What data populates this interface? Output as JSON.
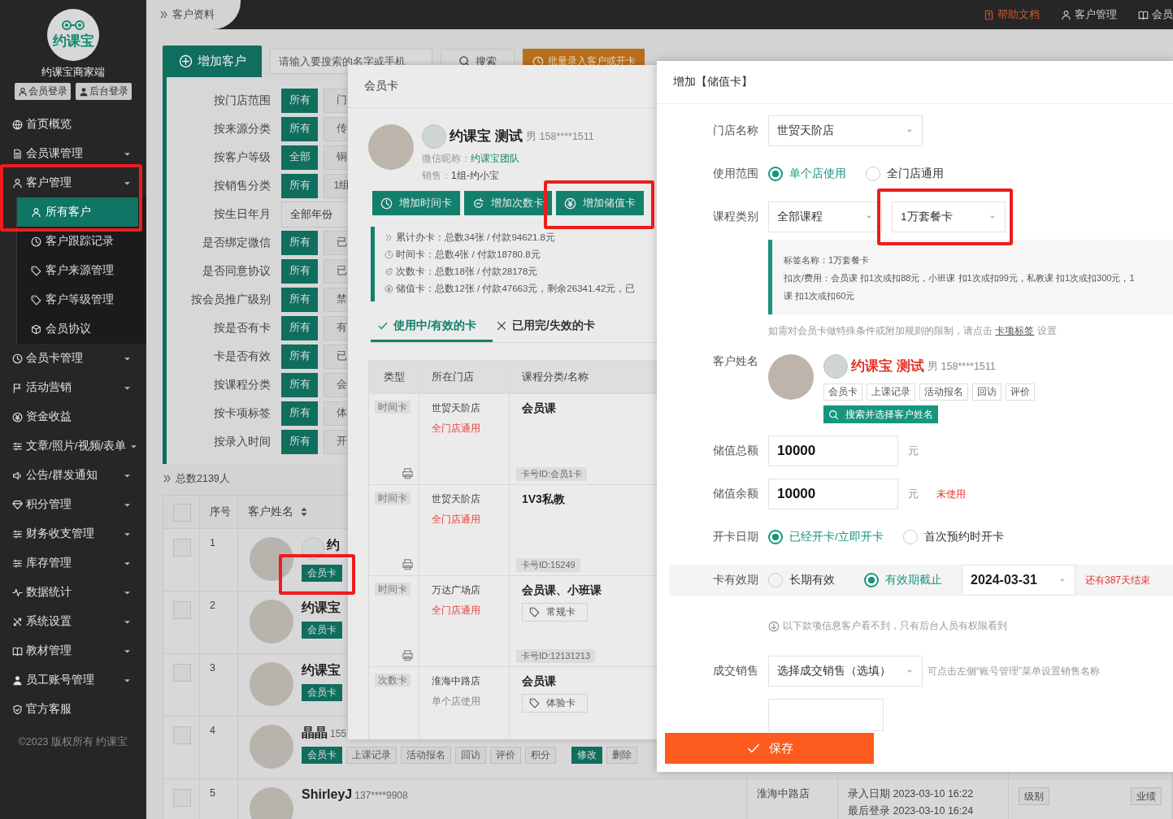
{
  "top_bar": {
    "breadcrumb": "客户资料",
    "links": [
      {
        "label": "帮助文档",
        "kind": "help"
      },
      {
        "label": "客户管理",
        "kind": "person"
      },
      {
        "label": "会员",
        "kind": "book"
      }
    ]
  },
  "sidebar": {
    "logo": "约课宝",
    "brand": "约课宝商家端",
    "login_buttons": [
      "会员登录",
      "后台登录"
    ],
    "items": [
      {
        "label": "首页概览",
        "kind": "link"
      },
      {
        "label": "会员课管理",
        "kind": "menu"
      },
      {
        "label": "客户管理",
        "kind": "menu",
        "children": [
          {
            "label": "所有客户",
            "selected": true
          },
          {
            "label": "客户跟踪记录",
            "selected": false
          },
          {
            "label": "客户来源管理",
            "selected": false
          },
          {
            "label": "客户等级管理",
            "selected": false
          },
          {
            "label": "会员协议",
            "selected": false
          }
        ]
      },
      {
        "label": "会员卡管理",
        "kind": "menu"
      },
      {
        "label": "活动营销",
        "kind": "menu"
      },
      {
        "label": "资金收益",
        "kind": "link"
      },
      {
        "label": "文章/照片/视频/表单",
        "kind": "menu"
      },
      {
        "label": "公告/群发通知",
        "kind": "menu"
      },
      {
        "label": "积分管理",
        "kind": "menu"
      },
      {
        "label": "财务收支管理",
        "kind": "menu"
      },
      {
        "label": "库存管理",
        "kind": "menu"
      },
      {
        "label": "数据统计",
        "kind": "menu"
      },
      {
        "label": "系统设置",
        "kind": "menu"
      },
      {
        "label": "教材管理",
        "kind": "menu"
      },
      {
        "label": "员工账号管理",
        "kind": "menu"
      },
      {
        "label": "官方客服",
        "kind": "link"
      }
    ],
    "copyright": "©2023 版权所有 约课宝"
  },
  "toolbar": {
    "add_button": "增加客户",
    "search": {
      "placeholder": "请输入要搜索的名字或手机"
    },
    "search_button": "搜索",
    "batch_button": "批量录入客户或开卡"
  },
  "filters": [
    {
      "label": "按门店范围",
      "kind": "chips",
      "options": [
        {
          "label": "所有",
          "selected": true
        },
        {
          "label": "门",
          "selected": false
        }
      ]
    },
    {
      "label": "按来源分类",
      "kind": "chips",
      "options": [
        {
          "label": "所有",
          "selected": true
        },
        {
          "label": "传",
          "selected": false
        }
      ]
    },
    {
      "label": "按客户等级",
      "kind": "chips",
      "options": [
        {
          "label": "全部",
          "selected": true
        },
        {
          "label": "铜",
          "selected": false
        }
      ]
    },
    {
      "label": "按销售分类",
      "kind": "chips",
      "options": [
        {
          "label": "所有",
          "selected": true
        },
        {
          "label": "1组",
          "selected": false
        }
      ]
    },
    {
      "label": "按生日年月",
      "kind": "select",
      "value": "全部年份"
    },
    {
      "label": "是否绑定微信",
      "kind": "chips",
      "options": [
        {
          "label": "所有",
          "selected": true
        },
        {
          "label": "已",
          "selected": false
        }
      ]
    },
    {
      "label": "是否同意协议",
      "kind": "chips",
      "options": [
        {
          "label": "所有",
          "selected": true
        },
        {
          "label": "已",
          "selected": false
        }
      ]
    },
    {
      "label": "按会员推广级别",
      "kind": "chips",
      "options": [
        {
          "label": "所有",
          "selected": true
        },
        {
          "label": "禁",
          "selected": false
        }
      ]
    },
    {
      "label": "按是否有卡",
      "kind": "chips",
      "options": [
        {
          "label": "所有",
          "selected": true
        },
        {
          "label": "有",
          "selected": false
        }
      ]
    },
    {
      "label": "卡是否有效",
      "kind": "chips",
      "options": [
        {
          "label": "所有",
          "selected": true
        },
        {
          "label": "已",
          "selected": false
        }
      ]
    },
    {
      "label": "按课程分类",
      "kind": "chips",
      "options": [
        {
          "label": "所有",
          "selected": true
        },
        {
          "label": "会",
          "selected": false
        }
      ]
    },
    {
      "label": "按卡项标签",
      "kind": "chips",
      "options": [
        {
          "label": "所有",
          "selected": true
        },
        {
          "label": "体",
          "selected": false
        }
      ]
    },
    {
      "label": "按录入时间",
      "kind": "chips",
      "options": [
        {
          "label": "所有",
          "selected": true
        },
        {
          "label": "开",
          "selected": false
        }
      ]
    }
  ],
  "total": "总数2139人",
  "customers": {
    "columns": [
      "序号",
      "客户姓名"
    ],
    "header_checked": false,
    "rows": [
      {
        "index": "1",
        "name": "约",
        "badge": true,
        "checked": false,
        "actions": [
          {
            "label": "会员卡",
            "kind": "card"
          }
        ]
      },
      {
        "index": "2",
        "name": "约课宝",
        "badge": false,
        "checked": false,
        "actions": [
          {
            "label": "会员卡",
            "kind": "card"
          }
        ]
      },
      {
        "index": "3",
        "name": "约课宝",
        "badge": false,
        "checked": false,
        "actions": [
          {
            "label": "会员卡",
            "kind": "card"
          }
        ]
      },
      {
        "index": "4",
        "name": "晶晶",
        "phone": "155",
        "badge": false,
        "checked": false,
        "actions": [
          {
            "label": "会员卡",
            "kind": "card"
          },
          {
            "label": "上课记录",
            "kind": "plain"
          },
          {
            "label": "活动报名",
            "kind": "plain"
          },
          {
            "label": "回访",
            "kind": "plain"
          },
          {
            "label": "评价",
            "kind": "plain"
          },
          {
            "label": "积分",
            "kind": "plain"
          },
          {
            "label": "修改",
            "kind": "edit"
          },
          {
            "label": "删除",
            "kind": "plain"
          }
        ]
      },
      {
        "index": "5",
        "name": "ShirleyJ",
        "phone": "137****9908",
        "badge": false,
        "checked": false,
        "store": "淮海中路店",
        "entry_date": "录入日期 2023-03-10 16:22",
        "last_login": "最后登录 2023-03-10 16:24",
        "tags": [
          "级别",
          "业绩"
        ]
      }
    ]
  },
  "member_card_modal": {
    "title": "会员卡",
    "customer": {
      "name": "约课宝 测试",
      "gender": "男",
      "phone": "158****1511",
      "wechat_label": "微信昵称：",
      "wechat": "约课宝团队",
      "sales_label": "销售：",
      "sales": "1组-约小宝"
    },
    "buttons": [
      "增加时间卡",
      "增加次数卡",
      "增加储值卡"
    ],
    "stats": [
      "累计办卡：总数34张 / 付款94621.8元",
      "时间卡：总数4张 / 付款18780.8元",
      "次数卡：总数18张 / 付款28178元",
      "储值卡：总数12张 / 付款47663元，剩余26341.42元，已"
    ],
    "tabs": [
      {
        "label": "使用中/有效的卡",
        "selected": true
      },
      {
        "label": "已用完/失效的卡",
        "selected": false
      }
    ],
    "table": {
      "columns": [
        "类型",
        "所在门店",
        "课程分类/名称"
      ],
      "rows": [
        {
          "type": "时间卡",
          "store": "世贸天阶店",
          "scope": "全门店通用",
          "shared": true,
          "course": "会员课",
          "card_id": "卡号ID:会员1卡"
        },
        {
          "type": "时间卡",
          "store": "世贸天阶店",
          "scope": "全门店通用",
          "shared": true,
          "course": "1V3私教",
          "card_id": "卡号ID:15249"
        },
        {
          "type": "时间卡",
          "store": "万达广场店",
          "scope": "全门店通用",
          "shared": true,
          "course": "会员课、小班课",
          "tag": "常规卡",
          "card_id": "卡号ID:12131213"
        },
        {
          "type": "次数卡",
          "store": "淮海中路店",
          "scope": "单个店使用",
          "shared": false,
          "course": "会员课",
          "tag": "体验卡"
        }
      ]
    }
  },
  "store_card_modal": {
    "title": "增加【储值卡】",
    "fields": [
      {
        "kind": "select",
        "label": "门店名称",
        "value": "世贸天阶店"
      },
      {
        "kind": "radio",
        "label": "使用范围",
        "options": [
          {
            "label": "单个店使用",
            "selected": true
          },
          {
            "label": "全门店通用",
            "selected": false
          }
        ]
      },
      {
        "kind": "course",
        "label": "课程类别",
        "values": [
          "全部课程",
          "1万套餐卡"
        ],
        "info": [
          "标签名称：1万套餐卡",
          "扣次/费用：会员课 扣1次或扣88元，小班课 扣1次或扣99元，私教课 扣1次或扣300元，1",
          "课 扣1次或扣60元"
        ],
        "hint": "如需对会员卡做特殊条件或附加规则的限制，请点击",
        "hint_link": "卡项标签",
        "hint_suffix": "设置"
      },
      {
        "kind": "customer",
        "label": "客户姓名",
        "name": "约课宝 测试",
        "gender": "男",
        "phone": "158****1511",
        "tags": [
          "会员卡",
          "上课记录",
          "活动报名",
          "回访",
          "评价"
        ],
        "button": "搜索并选择客户姓名"
      },
      {
        "kind": "amount",
        "label": "储值总额",
        "value": "10000",
        "unit": "元"
      },
      {
        "kind": "amount",
        "label": "储值余额",
        "value": "10000",
        "unit": "元",
        "note": "未使用"
      },
      {
        "kind": "radio",
        "label": "开卡日期",
        "options": [
          {
            "label": "已经开卡/立即开卡",
            "selected": true
          },
          {
            "label": "首次预约时开卡",
            "selected": false
          }
        ]
      },
      {
        "kind": "validity",
        "label": "卡有效期",
        "options": [
          {
            "label": "长期有效",
            "selected": false
          },
          {
            "label": "有效期截止",
            "selected": true
          }
        ],
        "date": "2024-03-31",
        "note": "还有387天结束"
      },
      {
        "kind": "notice",
        "text": "以下款项信息客户看不到，只有后台人员有权限看到"
      },
      {
        "kind": "sales",
        "label": "成交销售",
        "placeholder": "选择成交销售（选填）",
        "hint": "可点击左侧“账号管理”菜单设置销售名称"
      }
    ],
    "save_button": "保存"
  }
}
